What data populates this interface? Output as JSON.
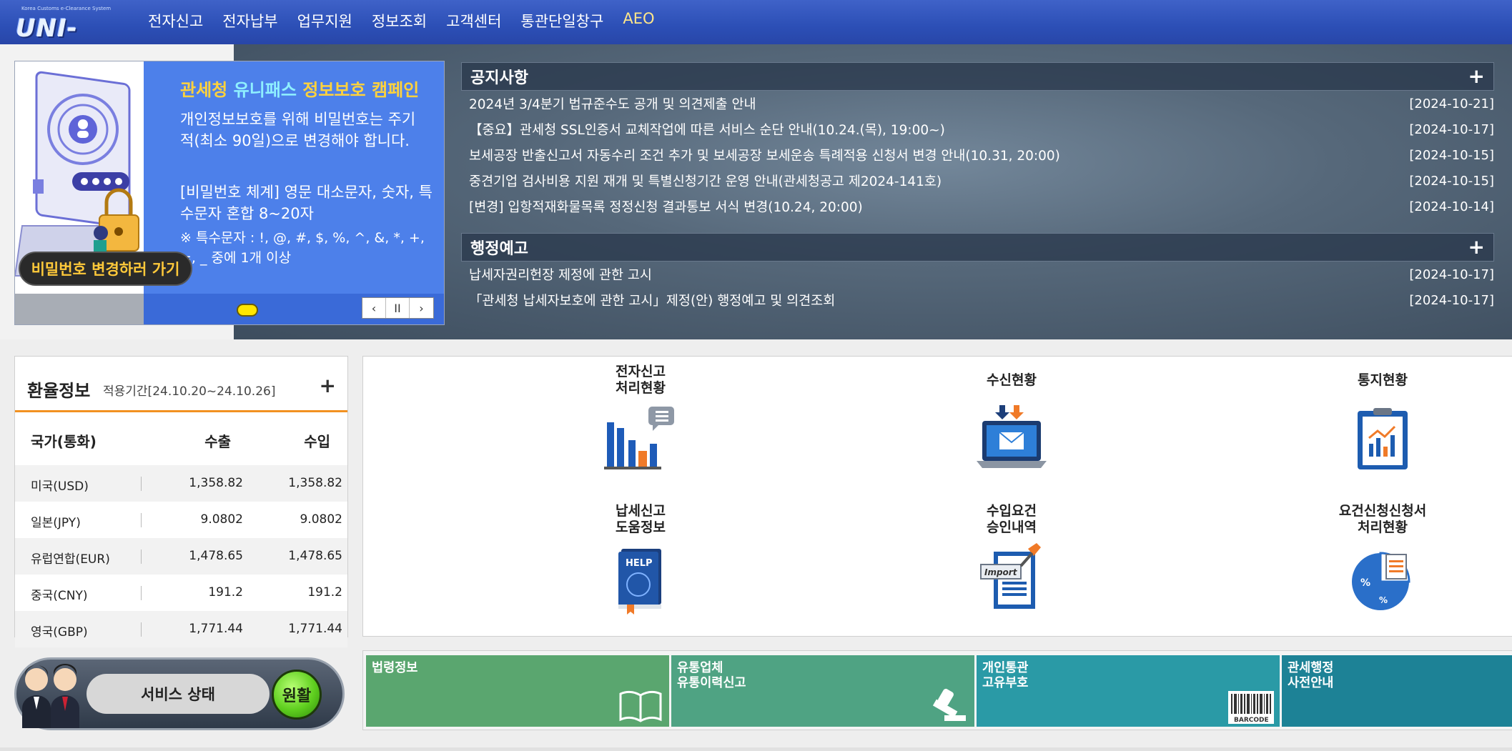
{
  "header": {
    "logo_small": "Korea Customs e-Clearance System",
    "logo_text": "UNI-PASS",
    "nav": [
      "전자신고",
      "전자납부",
      "업무지원",
      "정보조회",
      "고객센터",
      "통관단일창구",
      "AEO"
    ]
  },
  "banner": {
    "title_a": "관세청",
    "title_b": "유니패스",
    "title_c": "정보보호",
    "title_d": "캠페인",
    "line1": "개인정보보호를 위해 비밀번호는 주기적(최소 90일)으로 변경해야 합니다.",
    "line2": "[비밀번호 체계] 영문 대소문자, 숫자, 특수문자 혼합 8~20자",
    "line3": "※ 특수문자 : !, @, #, $, %, ^, &, *, +, =, _ 중에 1개 이상",
    "button": "비밀번호 변경하러 가기",
    "ctrl_prev": "‹",
    "ctrl_pause": "II",
    "ctrl_next": "›"
  },
  "notice": {
    "title": "공지사항",
    "plus": "+",
    "items": [
      {
        "text": "2024년 3/4분기 법규준수도 공개 및 의견제출 안내",
        "date": "[2024-10-21]"
      },
      {
        "text": "【중요】관세청 SSL인증서 교체작업에 따른 서비스 순단 안내(10.24.(목), 19:00~)",
        "date": "[2024-10-17]"
      },
      {
        "text": "보세공장 반출신고서 자동수리 조건 추가 및 보세공장 보세운송 특례적용 신청서 변경 안내(10.31, 20:00)",
        "date": "[2024-10-15]"
      },
      {
        "text": "중견기업 검사비용 지원 재개 및 특별신청기간 운영 안내(관세청공고 제2024-141호)",
        "date": "[2024-10-15]"
      },
      {
        "text": "[변경] 입항적재화물목록 정정신청 결과통보 서식 변경(10.24, 20:00)",
        "date": "[2024-10-14]"
      }
    ]
  },
  "admin": {
    "title": "행정예고",
    "plus": "+",
    "items": [
      {
        "text": "납세자권리헌장 제정에 관한 고시",
        "date": "[2024-10-17]"
      },
      {
        "text": "「관세청 납세자보호에 관한 고시」제정(안) 행정예고 및 의견조회",
        "date": "[2024-10-17]"
      }
    ]
  },
  "exchange": {
    "title": "환율정보",
    "period": "적용기간[24.10.20~24.10.26]",
    "plus": "+",
    "headers": [
      "국가(통화)",
      "수출",
      "수입"
    ],
    "rows": [
      [
        "미국(USD)",
        "1,358.82",
        "1,358.82"
      ],
      [
        "일본(JPY)",
        "9.0802",
        "9.0802"
      ],
      [
        "유럽연합(EUR)",
        "1,478.65",
        "1,478.65"
      ],
      [
        "중국(CNY)",
        "191.2",
        "191.2"
      ],
      [
        "영국(GBP)",
        "1,771.44",
        "1,771.44"
      ]
    ]
  },
  "quick": [
    {
      "l1": "전자신고",
      "l2": "처리현황",
      "icon": "bar-chart-icon"
    },
    {
      "l1": "수신현황",
      "l2": "",
      "icon": "laptop-mail-icon"
    },
    {
      "l1": "통지현황",
      "l2": "",
      "icon": "clipboard-chart-icon"
    },
    {
      "l1": "납세신고",
      "l2": "도움정보",
      "icon": "help-book-icon"
    },
    {
      "l1": "수입요건",
      "l2": "승인내역",
      "icon": "import-document-icon"
    },
    {
      "l1": "요건신청신청서",
      "l2": "처리현황",
      "icon": "percent-pie-icon"
    }
  ],
  "status": {
    "label": "서비스 상태",
    "value": "원활"
  },
  "tiles": [
    {
      "l1": "법령정보",
      "l2": "",
      "color": "#5aa66f",
      "icon": "open-book-icon"
    },
    {
      "l1": "유통업체",
      "l2": "유통이력신고",
      "color": "#4fa383",
      "icon": "stamp-icon"
    },
    {
      "l1": "개인통관",
      "l2": "고유부호",
      "color": "#2a9aa6",
      "icon": "barcode-icon"
    },
    {
      "l1": "관세행정",
      "l2": "사전안내",
      "color": "#1d8296",
      "icon": "info-icon"
    }
  ],
  "tile_barcode_text": "BARCODE"
}
